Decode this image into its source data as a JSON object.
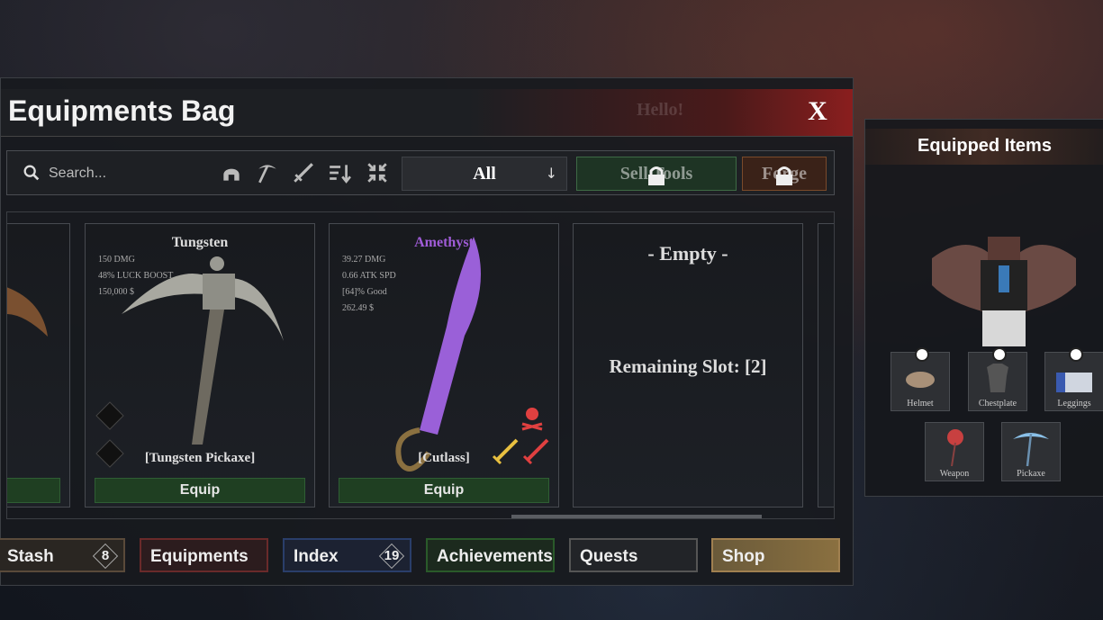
{
  "background": {
    "ghost_text": "Hello!"
  },
  "bag": {
    "title": "Equipments Bag",
    "close_label": "X",
    "search": {
      "placeholder": "Search..."
    },
    "filter_icons": [
      "helmet-icon",
      "pickaxe-icon",
      "sword-icon",
      "sort-icon",
      "collapse-icon"
    ],
    "dropdown": {
      "selected": "All"
    },
    "sell_tools_label": "Sell Tools",
    "forge_label": "Forge",
    "items": [
      {
        "name": "Tungsten",
        "stats": [
          "150 DMG",
          "48% LUCK BOOST",
          "150,000 $"
        ],
        "item_label": "[Tungsten Pickaxe]",
        "equip_label": "Equip",
        "name_color": "#d8d8d8"
      },
      {
        "name": "Amethyst",
        "stats": [
          "39.27 DMG",
          "0.66 ATK SPD",
          "[64]% Good",
          "262.49 $"
        ],
        "item_label": "[Cutlass]",
        "equip_label": "Equip",
        "name_color": "#a05cd8"
      }
    ],
    "empty_slot": {
      "title": "- Empty -",
      "remaining": "Remaining Slot: [2]"
    }
  },
  "tabs": [
    {
      "label": "Stash",
      "count": "8",
      "color": "#5a4a3a"
    },
    {
      "label": "Equipments",
      "color": "#6a2a2a"
    },
    {
      "label": "Index",
      "count": "19",
      "color": "#2a3e6a"
    },
    {
      "label": "Achievements",
      "color": "#2a5a2a"
    },
    {
      "label": "Quests",
      "color": "#3a3c40"
    },
    {
      "label": "Shop",
      "color": "#8a7040"
    }
  ],
  "equipped": {
    "title": "Equipped Items",
    "slots": [
      {
        "label": "Helmet"
      },
      {
        "label": "Chestplate"
      },
      {
        "label": "Leggings"
      },
      {
        "label": "Weapon"
      },
      {
        "label": "Pickaxe"
      }
    ]
  }
}
